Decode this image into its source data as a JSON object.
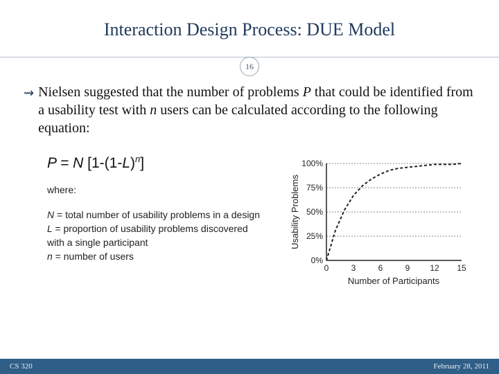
{
  "title": "Interaction Design Process: DUE Model",
  "page_number": "16",
  "bullet_prefix": "Nielsen suggested that the number of problems ",
  "bullet_var_P": "P",
  "bullet_mid": " that could be identified from a usability test with ",
  "bullet_var_n": "n",
  "bullet_suffix": " users can be calculated according to the following equation:",
  "equation_lhs": "P = N ",
  "equation_bracket_open": "[1-(1-",
  "equation_L": "L",
  "equation_bracket_mid": ")",
  "equation_sup": "n",
  "equation_bracket_close": "]",
  "where_label": "where:",
  "def_N_sym": "N ",
  "def_N_text": " = total number of usability problems in a design",
  "def_L_sym": "L ",
  "def_L_text": " = proportion of usability problems discovered with a single participant",
  "def_n_sym": "n",
  "def_n_text": " = number of users",
  "footer_left": "CS 320",
  "footer_right": "February 28, 2011",
  "chart_data": {
    "type": "line",
    "title": "",
    "xlabel": "Number of Participants",
    "ylabel": "Usability Problems",
    "x": [
      0,
      3,
      6,
      9,
      12,
      15
    ],
    "y_ticks": [
      "0%",
      "25%",
      "50%",
      "75%",
      "100%"
    ],
    "xlim": [
      0,
      15
    ],
    "ylim": [
      0,
      100
    ],
    "series": [
      {
        "name": "problems_found_pct",
        "x": [
          0,
          1,
          2,
          3,
          4,
          5,
          6,
          7,
          8,
          9,
          10,
          11,
          12,
          14,
          15
        ],
        "y": [
          0,
          31,
          52,
          67,
          77,
          84,
          89,
          93,
          95,
          96,
          97,
          98,
          99,
          99,
          100
        ]
      }
    ]
  }
}
